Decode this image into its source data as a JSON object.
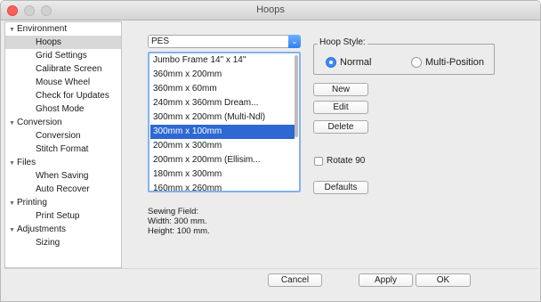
{
  "window": {
    "title": "Hoops"
  },
  "sidebar": {
    "items": [
      {
        "label": "Environment",
        "type": "group"
      },
      {
        "label": "Hoops",
        "type": "child",
        "selected": true
      },
      {
        "label": "Grid Settings",
        "type": "child"
      },
      {
        "label": "Calibrate Screen",
        "type": "child"
      },
      {
        "label": "Mouse Wheel",
        "type": "child"
      },
      {
        "label": "Check for Updates",
        "type": "child"
      },
      {
        "label": "Ghost Mode",
        "type": "child"
      },
      {
        "label": "Conversion",
        "type": "group"
      },
      {
        "label": "Conversion",
        "type": "child"
      },
      {
        "label": "Stitch Format",
        "type": "child"
      },
      {
        "label": "Files",
        "type": "group"
      },
      {
        "label": "When Saving",
        "type": "child"
      },
      {
        "label": "Auto Recover",
        "type": "child"
      },
      {
        "label": "Printing",
        "type": "group"
      },
      {
        "label": "Print Setup",
        "type": "child"
      },
      {
        "label": "Adjustments",
        "type": "group"
      },
      {
        "label": "Sizing",
        "type": "child"
      }
    ]
  },
  "format_select": {
    "value": "PES"
  },
  "hoop_list": {
    "items": [
      "Jumbo Frame 14\" x 14\"",
      "360mm x 200mm",
      "360mm x 60mm",
      "240mm x 360mm Dream...",
      "300mm x 200mm (Multi-Ndl)",
      "300mm x 100mm",
      "200mm x 300mm",
      "200mm x 200mm (Ellisim...",
      "180mm x 300mm",
      "160mm x 260mm"
    ],
    "selected_index": 5
  },
  "sewing_field": {
    "heading": "Sewing Field:",
    "width": "Width: 300 mm.",
    "height": "Height: 100 mm."
  },
  "hoop_style": {
    "label": "Hoop Style:",
    "options": [
      {
        "label": "Normal",
        "checked": true
      },
      {
        "label": "Multi-Position",
        "checked": false
      }
    ]
  },
  "buttons": {
    "new": "New",
    "edit": "Edit",
    "delete": "Delete",
    "defaults": "Defaults",
    "cancel": "Cancel",
    "apply": "Apply",
    "ok": "OK"
  },
  "rotate": {
    "label": "Rotate 90",
    "checked": false
  },
  "icons": {
    "group_expanded": "▼",
    "combo_arrow": "⌄"
  },
  "colors": {
    "accent": "#2d68d3",
    "close": "#fc605c"
  }
}
